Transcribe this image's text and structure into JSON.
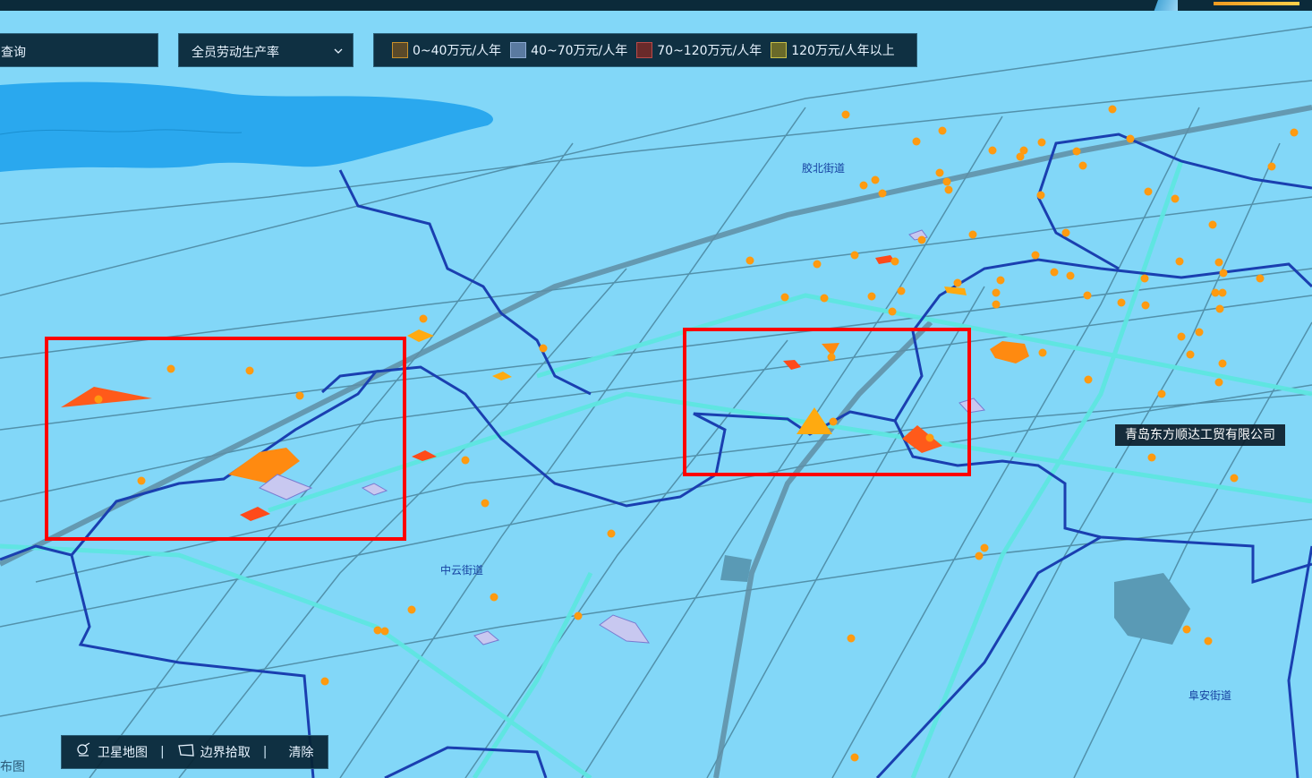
{
  "search": {
    "label": "查询"
  },
  "indicator_select": {
    "value": "全员劳动生产率"
  },
  "legend": {
    "items": [
      {
        "label": "0~40万元/人年",
        "fill": "#5a4a2a",
        "stroke": "#c9902a"
      },
      {
        "label": "40~70万元/人年",
        "fill": "#5a7aa0",
        "stroke": "#8aa8d0"
      },
      {
        "label": "70~120万元/人年",
        "fill": "#6a2a2a",
        "stroke": "#b84a4a"
      },
      {
        "label": "120万元/人年以上",
        "fill": "#6a6a2a",
        "stroke": "#c8c048"
      }
    ]
  },
  "map": {
    "districts": [
      "胶北街道",
      "中云街道",
      "阜安街道"
    ],
    "selected_company": "青岛东方顺达工贸有限公司",
    "colors": {
      "land": "#82d7f8",
      "water": "#2aa8ee",
      "road": "#4d8aa3",
      "highway": "#5ee6e0",
      "boundary": "#1a3fb0",
      "point": "#ff9a10",
      "selection": "#ff0000"
    }
  },
  "toolbar": {
    "satellite": "卫星地图",
    "boundary_pick": "边界拾取",
    "clear": "清除"
  },
  "partial_label": "布图"
}
